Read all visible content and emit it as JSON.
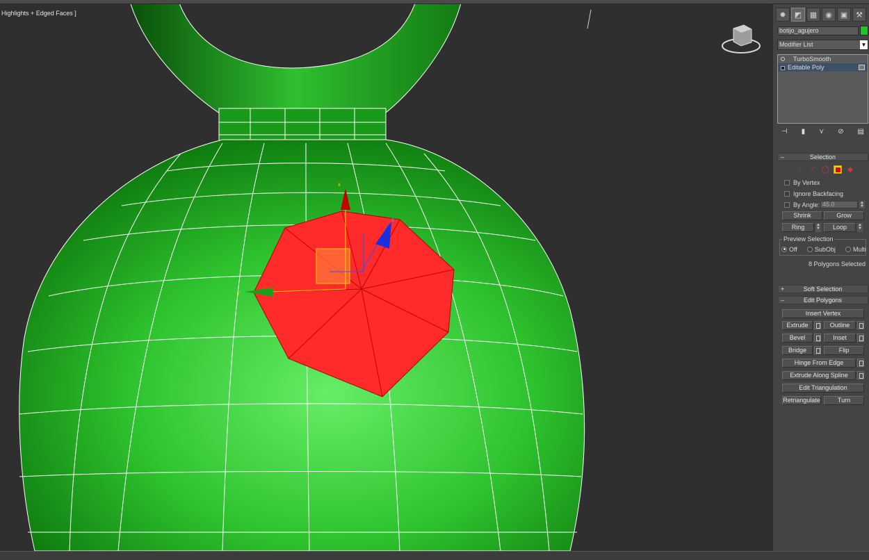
{
  "viewport": {
    "label": "Highlights + Edged Faces ]",
    "object_color": "#2ab82a",
    "selection_color": "#ff2a2a"
  },
  "panel": {
    "tabs": [
      "create-icon",
      "modify-icon",
      "hierarchy-icon",
      "motion-icon",
      "display-icon",
      "utilities-icon"
    ],
    "object_name": "botijo_agujero",
    "object_color": "#22c22c",
    "modifier_list_label": "Modifier List",
    "stack": [
      {
        "label": "TurboSmooth",
        "selected": false
      },
      {
        "label": "Editable Poly",
        "selected": true
      }
    ],
    "selection": {
      "title": "Selection",
      "by_vertex": "By Vertex",
      "ignore_backfacing": "Ignore Backfacing",
      "by_angle": "By Angle:",
      "angle_value": "45.0",
      "shrink": "Shrink",
      "grow": "Grow",
      "ring": "Ring",
      "loop": "Loop",
      "preview_title": "Preview Selection",
      "preview_off": "Off",
      "preview_subobj": "SubObj",
      "preview_multi": "Multi",
      "status": "8 Polygons Selected"
    },
    "soft_selection": {
      "title": "Soft Selection"
    },
    "edit_polygons": {
      "title": "Edit Polygons",
      "insert_vertex": "Insert Vertex",
      "extrude": "Extrude",
      "outline": "Outline",
      "bevel": "Bevel",
      "inset": "Inset",
      "bridge": "Bridge",
      "flip": "Flip",
      "hinge_from_edge": "Hinge From Edge",
      "extrude_along_spline": "Extrude Along Spline",
      "edit_triangulation": "Edit Triangulation",
      "retriangulate": "Retriangulate",
      "turn": "Turn"
    },
    "gizmo_axes": {
      "x": "x",
      "y": "y",
      "z": "z"
    }
  }
}
